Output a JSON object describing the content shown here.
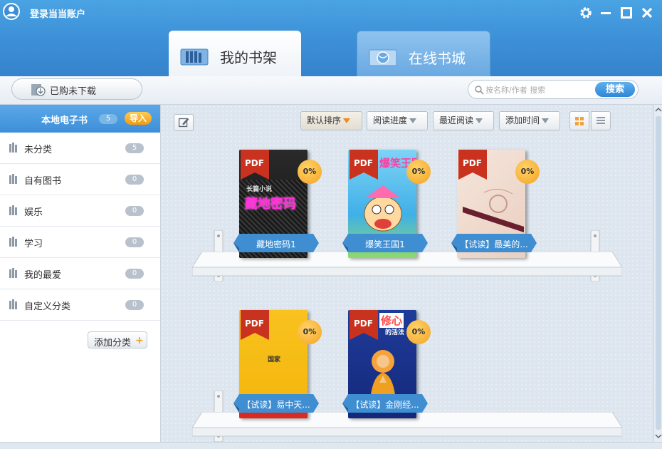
{
  "header": {
    "login_label": "登录当当账户",
    "tabs": [
      {
        "label": "我的书架",
        "active": true
      },
      {
        "label": "在线书城",
        "active": false
      }
    ],
    "accent_color": "#3c8fd6"
  },
  "toolbar": {
    "purchased_label": "已购未下载",
    "search_placeholder": "按名称/作者 搜索",
    "search_button": "搜索"
  },
  "sidebar": {
    "header_label": "本地电子书",
    "header_count": "5",
    "import_label": "导入",
    "categories": [
      {
        "label": "未分类",
        "count": "5"
      },
      {
        "label": "自有图书",
        "count": "0"
      },
      {
        "label": "娱乐",
        "count": "0"
      },
      {
        "label": "学习",
        "count": "0"
      },
      {
        "label": "我的最爱",
        "count": "0"
      },
      {
        "label": "自定义分类",
        "count": "0"
      }
    ],
    "add_category_label": "添加分类"
  },
  "sort": {
    "default_label": "默认排序",
    "progress_label": "阅读进度",
    "recent_label": "最近阅读",
    "added_label": "添加时间"
  },
  "books": [
    {
      "title": "藏地密码1",
      "badge": "PDF",
      "progress": "0%",
      "cover_text": "藏地密码",
      "cover_sub": "长篇小说"
    },
    {
      "title": "爆笑王国1",
      "badge": "PDF",
      "progress": "0%",
      "cover_text": "爆笑王国"
    },
    {
      "title": "【试读】最美的...",
      "badge": "PDF",
      "progress": "0%"
    },
    {
      "title": "【试读】易中天...",
      "badge": "PDF",
      "progress": "0%",
      "cover_text": "国家"
    },
    {
      "title": "【试读】金刚经...",
      "badge": "PDF",
      "progress": "0%",
      "cover_text": "修心",
      "cover_sub": "的活法"
    }
  ]
}
